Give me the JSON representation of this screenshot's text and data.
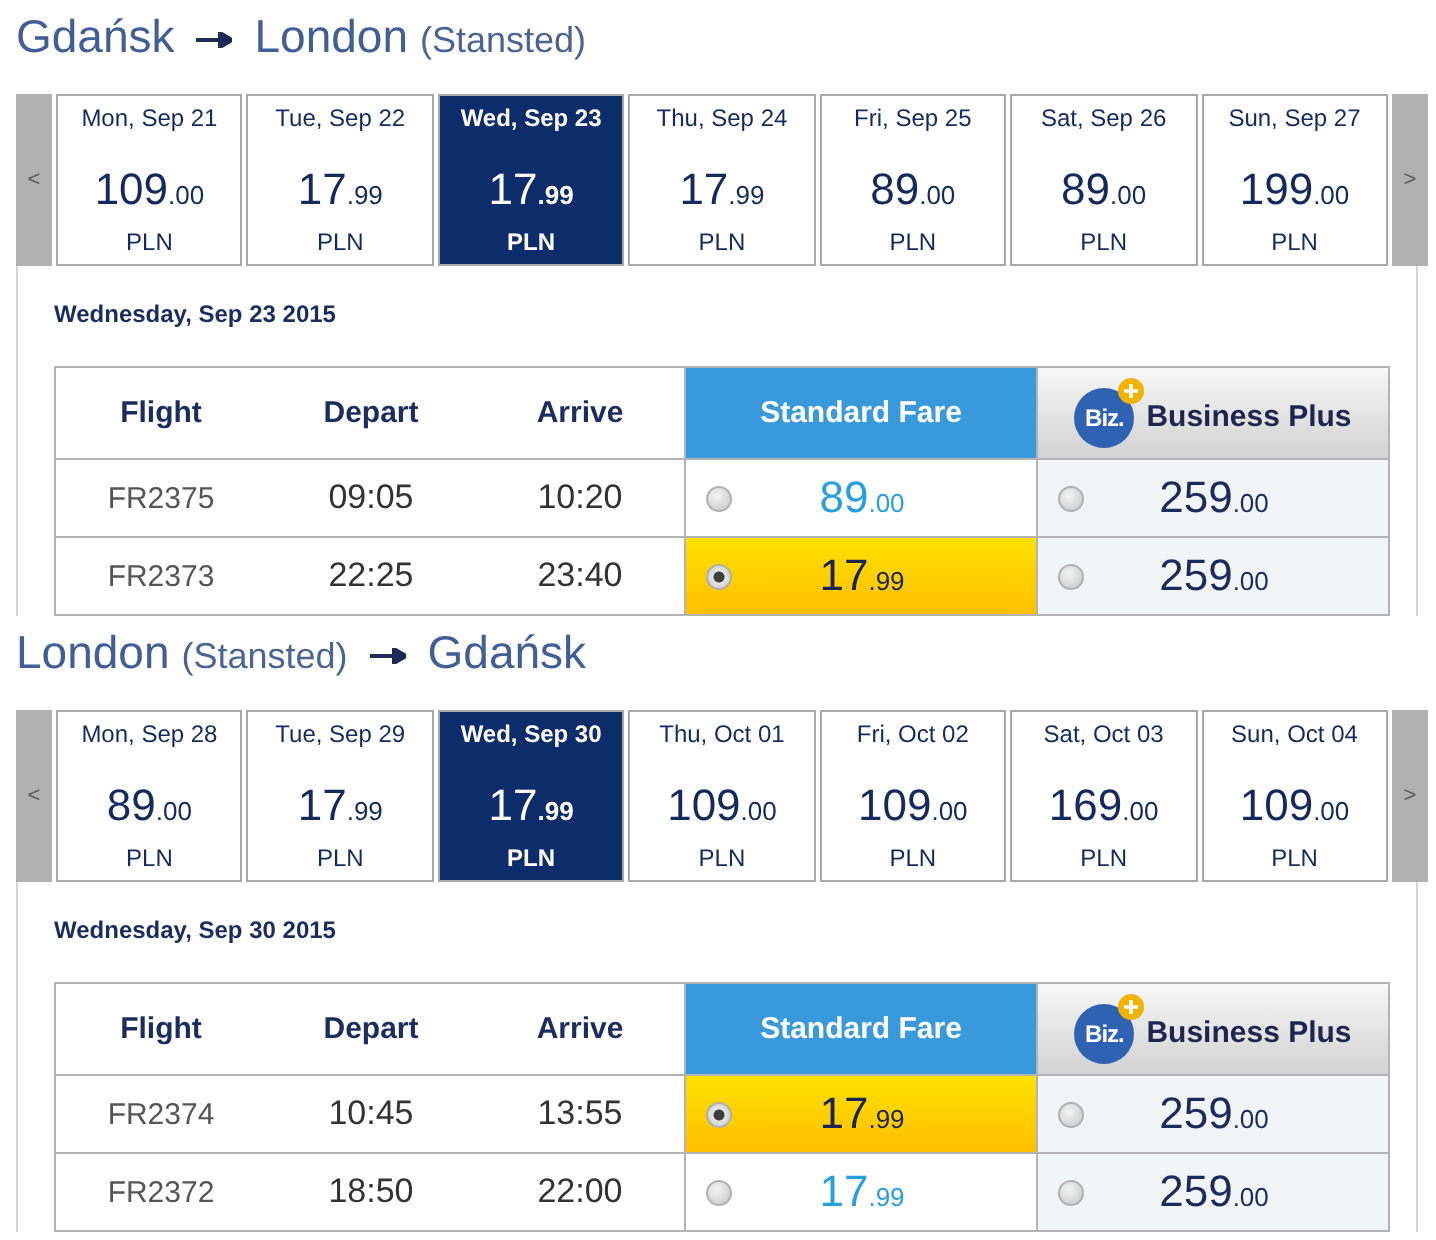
{
  "sections": [
    {
      "route": [
        {
          "city": "Gdańsk"
        },
        {
          "city": "London",
          "airport": "(Stansted)"
        }
      ],
      "dates": {
        "prev": "<",
        "next": ">",
        "days": [
          {
            "day": "Mon, Sep 21",
            "amount": "109",
            "cents": ".00",
            "currency": "PLN",
            "selected": false
          },
          {
            "day": "Tue, Sep 22",
            "amount": "17",
            "cents": ".99",
            "currency": "PLN",
            "selected": false
          },
          {
            "day": "Wed, Sep 23",
            "amount": "17",
            "cents": ".99",
            "currency": "PLN",
            "selected": true
          },
          {
            "day": "Thu, Sep 24",
            "amount": "17",
            "cents": ".99",
            "currency": "PLN",
            "selected": false
          },
          {
            "day": "Fri, Sep 25",
            "amount": "89",
            "cents": ".00",
            "currency": "PLN",
            "selected": false
          },
          {
            "day": "Sat, Sep 26",
            "amount": "89",
            "cents": ".00",
            "currency": "PLN",
            "selected": false
          },
          {
            "day": "Sun, Sep 27",
            "amount": "199",
            "cents": ".00",
            "currency": "PLN",
            "selected": false
          }
        ]
      },
      "date_heading": "Wednesday, Sep 23 2015",
      "table": {
        "columns": [
          {
            "kind": "info",
            "label": "Flight"
          },
          {
            "kind": "info",
            "label": "Depart"
          },
          {
            "kind": "info",
            "label": "Arrive"
          },
          {
            "kind": "standard",
            "label": "Standard Fare"
          },
          {
            "kind": "business",
            "label": "Business Plus",
            "logo": "Biz."
          }
        ],
        "rows": [
          {
            "flight": "FR2375",
            "depart": "09:05",
            "arrive": "10:20",
            "fares": [
              {
                "amount": "89",
                "cents": ".00",
                "selected": false
              },
              {
                "amount": "259",
                "cents": ".00",
                "selected": false
              }
            ]
          },
          {
            "flight": "FR2373",
            "depart": "22:25",
            "arrive": "23:40",
            "fares": [
              {
                "amount": "17",
                "cents": ".99",
                "selected": true
              },
              {
                "amount": "259",
                "cents": ".00",
                "selected": false
              }
            ]
          }
        ]
      }
    },
    {
      "route": [
        {
          "city": "London",
          "airport": "(Stansted)"
        },
        {
          "city": "Gdańsk"
        }
      ],
      "dates": {
        "prev": "<",
        "next": ">",
        "days": [
          {
            "day": "Mon, Sep 28",
            "amount": "89",
            "cents": ".00",
            "currency": "PLN",
            "selected": false
          },
          {
            "day": "Tue, Sep 29",
            "amount": "17",
            "cents": ".99",
            "currency": "PLN",
            "selected": false
          },
          {
            "day": "Wed, Sep 30",
            "amount": "17",
            "cents": ".99",
            "currency": "PLN",
            "selected": true
          },
          {
            "day": "Thu, Oct 01",
            "amount": "109",
            "cents": ".00",
            "currency": "PLN",
            "selected": false
          },
          {
            "day": "Fri, Oct 02",
            "amount": "109",
            "cents": ".00",
            "currency": "PLN",
            "selected": false
          },
          {
            "day": "Sat, Oct 03",
            "amount": "169",
            "cents": ".00",
            "currency": "PLN",
            "selected": false
          },
          {
            "day": "Sun, Oct 04",
            "amount": "109",
            "cents": ".00",
            "currency": "PLN",
            "selected": false
          }
        ]
      },
      "date_heading": "Wednesday, Sep 30 2015",
      "table": {
        "columns": [
          {
            "kind": "info",
            "label": "Flight"
          },
          {
            "kind": "info",
            "label": "Depart"
          },
          {
            "kind": "info",
            "label": "Arrive"
          },
          {
            "kind": "standard",
            "label": "Standard Fare"
          },
          {
            "kind": "business",
            "label": "Business Plus",
            "logo": "Biz."
          }
        ],
        "rows": [
          {
            "flight": "FR2374",
            "depart": "10:45",
            "arrive": "13:55",
            "fares": [
              {
                "amount": "17",
                "cents": ".99",
                "selected": true
              },
              {
                "amount": "259",
                "cents": ".00",
                "selected": false
              }
            ]
          },
          {
            "flight": "FR2372",
            "depart": "18:50",
            "arrive": "22:00",
            "fares": [
              {
                "amount": "17",
                "cents": ".99",
                "selected": false
              },
              {
                "amount": "259",
                "cents": ".00",
                "selected": false
              }
            ]
          }
        ]
      }
    }
  ]
}
